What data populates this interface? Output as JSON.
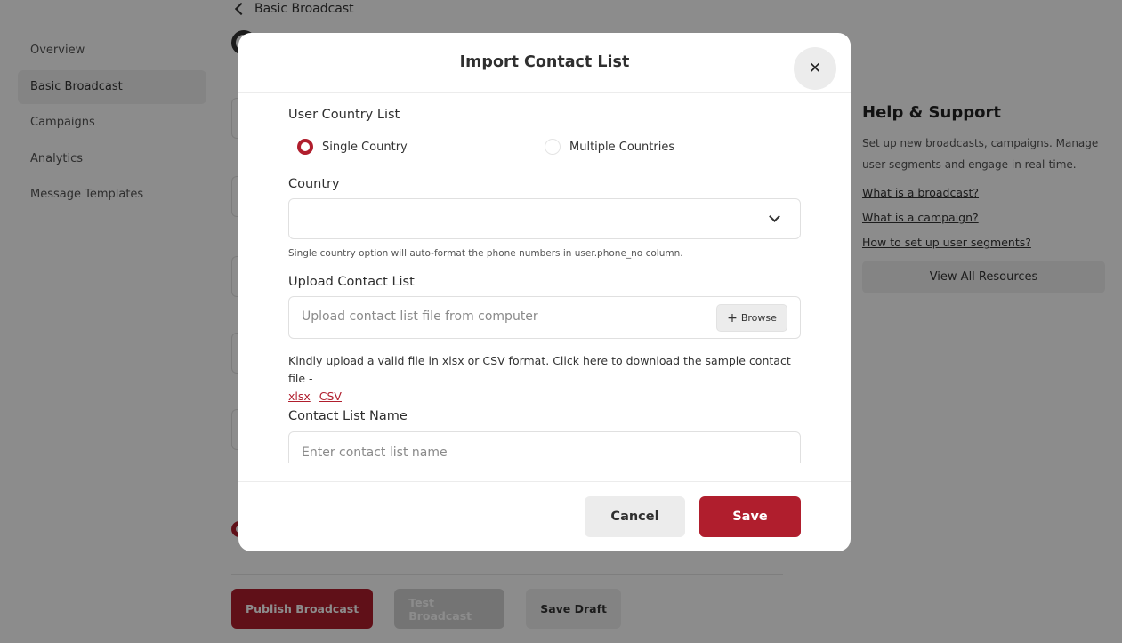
{
  "sidebar": {
    "items": [
      {
        "label": "Overview"
      },
      {
        "label": "Basic Broadcast"
      },
      {
        "label": "Campaigns"
      },
      {
        "label": "Analytics"
      },
      {
        "label": "Message Templates"
      }
    ]
  },
  "header": {
    "back_label": "Basic Broadcast"
  },
  "help": {
    "title": "Help & Support",
    "description": "Set up new broadcasts, campaigns. Manage user segments and engage in real-time.",
    "links": [
      {
        "label": "What is a broadcast?"
      },
      {
        "label": "What is a campaign?"
      },
      {
        "label": "How to set up user segments?"
      }
    ],
    "resources_button": "View All Resources"
  },
  "actions": {
    "publish": "Publish Broadcast",
    "test": "Test Broadcast",
    "draft": "Save Draft"
  },
  "modal": {
    "title": "Import Contact List",
    "user_country_list_label": "User Country List",
    "radio_single": "Single Country",
    "radio_multiple": "Multiple Countries",
    "selected_option": "Single Country",
    "country_label": "Country",
    "country_value": "",
    "country_hint": "Single country option will auto-format the phone numbers in user.phone_no column.",
    "upload_label": "Upload Contact List",
    "upload_placeholder": "Upload contact list file from computer",
    "browse_label": "Browse",
    "upload_hint": "Kindly upload a valid file in xlsx or CSV format. Click here to download the sample contact file -",
    "sample_links": [
      {
        "label": "xlsx"
      },
      {
        "label": "CSV"
      }
    ],
    "name_label": "Contact List Name",
    "name_placeholder": "Enter contact list name",
    "cancel_label": "Cancel",
    "save_label": "Save"
  },
  "colors": {
    "accent": "#b01e2d",
    "overlay": "rgba(0,0,0,0.45)"
  }
}
